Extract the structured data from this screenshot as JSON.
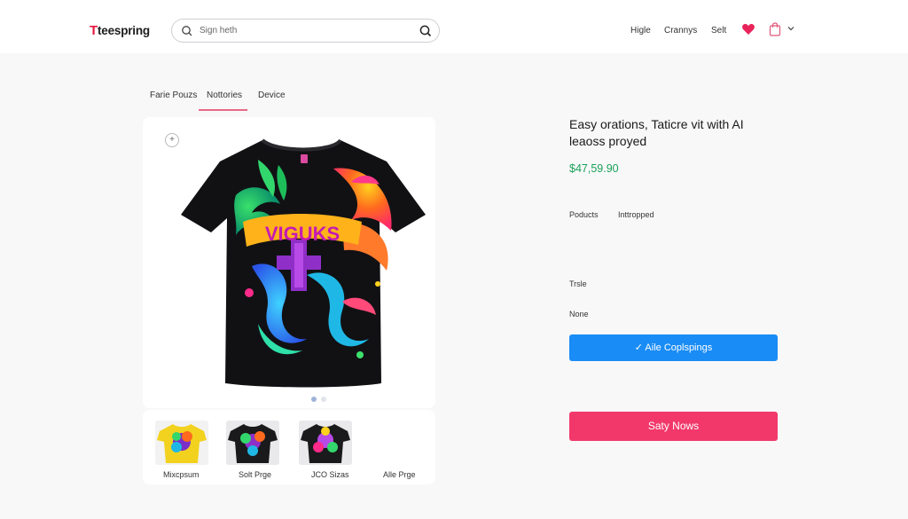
{
  "header": {
    "logo_mark": "T",
    "logo_text": "teespring",
    "search_placeholder": "Sign heth",
    "nav": [
      "Higle",
      "Crannys",
      "Selt"
    ]
  },
  "tabs": [
    "Farie Pouzs",
    "Nottories",
    "Device"
  ],
  "active_tab": 1,
  "product": {
    "zoom_symbol": "+",
    "shirt_text": "VIGUKS",
    "title": "Easy orations, Taticre vit with AI leaoss proyed",
    "price": "$47,59.90",
    "meta": [
      "Poducts",
      "Inttropped"
    ],
    "labels": [
      "Trsle",
      "None"
    ],
    "primary_button": "✓ Aile Coplspings",
    "buy_button": "Saty Nows"
  },
  "thumbnails": [
    {
      "label": "Mixcpsum",
      "bg": "#f2d21f"
    },
    {
      "label": "Solt Prge",
      "bg": "#222222"
    },
    {
      "label": "JCO Sizas",
      "bg": "#222222"
    },
    {
      "label": "Alle Prge",
      "bg": "#ffffff"
    }
  ],
  "colors": {
    "brand": "#e8173f",
    "accent_blue": "#1a8cf5",
    "accent_pink": "#f2386a",
    "price_green": "#1aa158"
  }
}
